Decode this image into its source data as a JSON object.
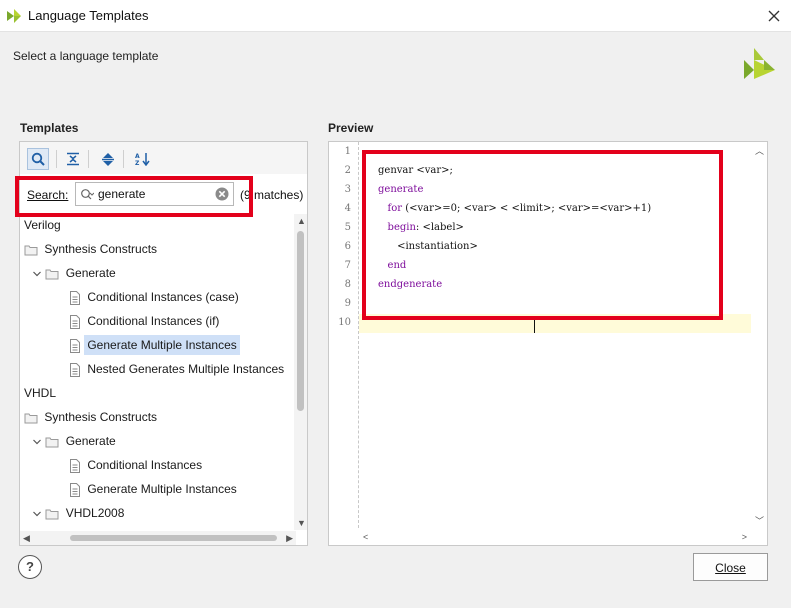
{
  "window": {
    "title": "Language Templates"
  },
  "header": {
    "subtitle": "Select a language template"
  },
  "templates": {
    "section_label": "Templates",
    "search_label": "Search:",
    "search_value": "generate",
    "matches_text": "(9 matches)",
    "tree": [
      {
        "label": "Verilog",
        "kind": "root"
      },
      {
        "label": "Synthesis Constructs",
        "kind": "folder"
      },
      {
        "label": "Generate",
        "kind": "folder-open"
      },
      {
        "label": "Conditional Instances (case)",
        "kind": "file"
      },
      {
        "label": "Conditional Instances (if)",
        "kind": "file"
      },
      {
        "label": "Generate Multiple Instances",
        "kind": "file",
        "selected": true
      },
      {
        "label": "Nested Generates Multiple Instances",
        "kind": "file"
      },
      {
        "label": "VHDL",
        "kind": "root"
      },
      {
        "label": "Synthesis Constructs",
        "kind": "folder"
      },
      {
        "label": "Generate",
        "kind": "folder-open"
      },
      {
        "label": "Conditional Instances",
        "kind": "file"
      },
      {
        "label": "Generate Multiple Instances",
        "kind": "file"
      },
      {
        "label": "VHDL2008",
        "kind": "folder-open"
      }
    ]
  },
  "preview": {
    "section_label": "Preview",
    "line_numbers": [
      "1",
      "2",
      "3",
      "4",
      "5",
      "6",
      "7",
      "8",
      "9",
      "10"
    ]
  },
  "footer": {
    "help_label": "?",
    "close_label": "Close"
  },
  "colors": {
    "highlight_box": "#e3001b",
    "keyword": "#7f0f9c",
    "selection": "#cfe0f7"
  }
}
